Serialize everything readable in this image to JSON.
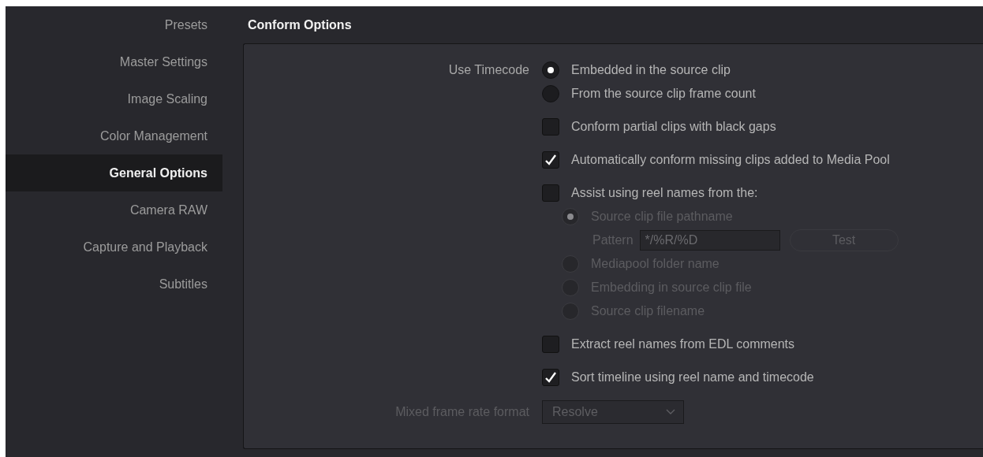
{
  "sidebar": {
    "items": [
      {
        "label": "Presets",
        "selected": false
      },
      {
        "label": "Master Settings",
        "selected": false
      },
      {
        "label": "Image Scaling",
        "selected": false
      },
      {
        "label": "Color Management",
        "selected": false
      },
      {
        "label": "General Options",
        "selected": true
      },
      {
        "label": "Camera RAW",
        "selected": false
      },
      {
        "label": "Capture and Playback",
        "selected": false
      },
      {
        "label": "Subtitles",
        "selected": false
      }
    ]
  },
  "section": {
    "title": "Conform Options",
    "rows": [
      {
        "kind": "radio-group",
        "label": "Use Timecode",
        "options": [
          {
            "label": "Embedded in the source clip",
            "selected": true
          },
          {
            "label": "From the source clip frame count",
            "selected": false
          }
        ]
      },
      {
        "kind": "checkbox",
        "label": "Conform partial clips with black gaps",
        "checked": false
      },
      {
        "kind": "checkbox",
        "label": "Automatically conform missing clips added to Media Pool",
        "checked": true
      },
      {
        "kind": "checkbox",
        "label": "Assist using reel names from the:",
        "checked": false
      },
      {
        "kind": "sub-radio-group",
        "disabled": true,
        "options": [
          {
            "label": "Source clip file pathname",
            "selected": true,
            "pattern": {
              "label": "Pattern",
              "value": "*/%R/%D",
              "button": "Test"
            }
          },
          {
            "label": "Mediapool folder name",
            "selected": false
          },
          {
            "label": "Embedding in source clip file",
            "selected": false
          },
          {
            "label": "Source clip filename",
            "selected": false
          }
        ]
      },
      {
        "kind": "checkbox",
        "label": "Extract reel names from EDL comments",
        "checked": false
      },
      {
        "kind": "checkbox",
        "label": "Sort timeline using reel name and timecode",
        "checked": true
      },
      {
        "kind": "select",
        "label": "Mixed frame rate format",
        "value": "Resolve",
        "disabled": true
      }
    ]
  }
}
